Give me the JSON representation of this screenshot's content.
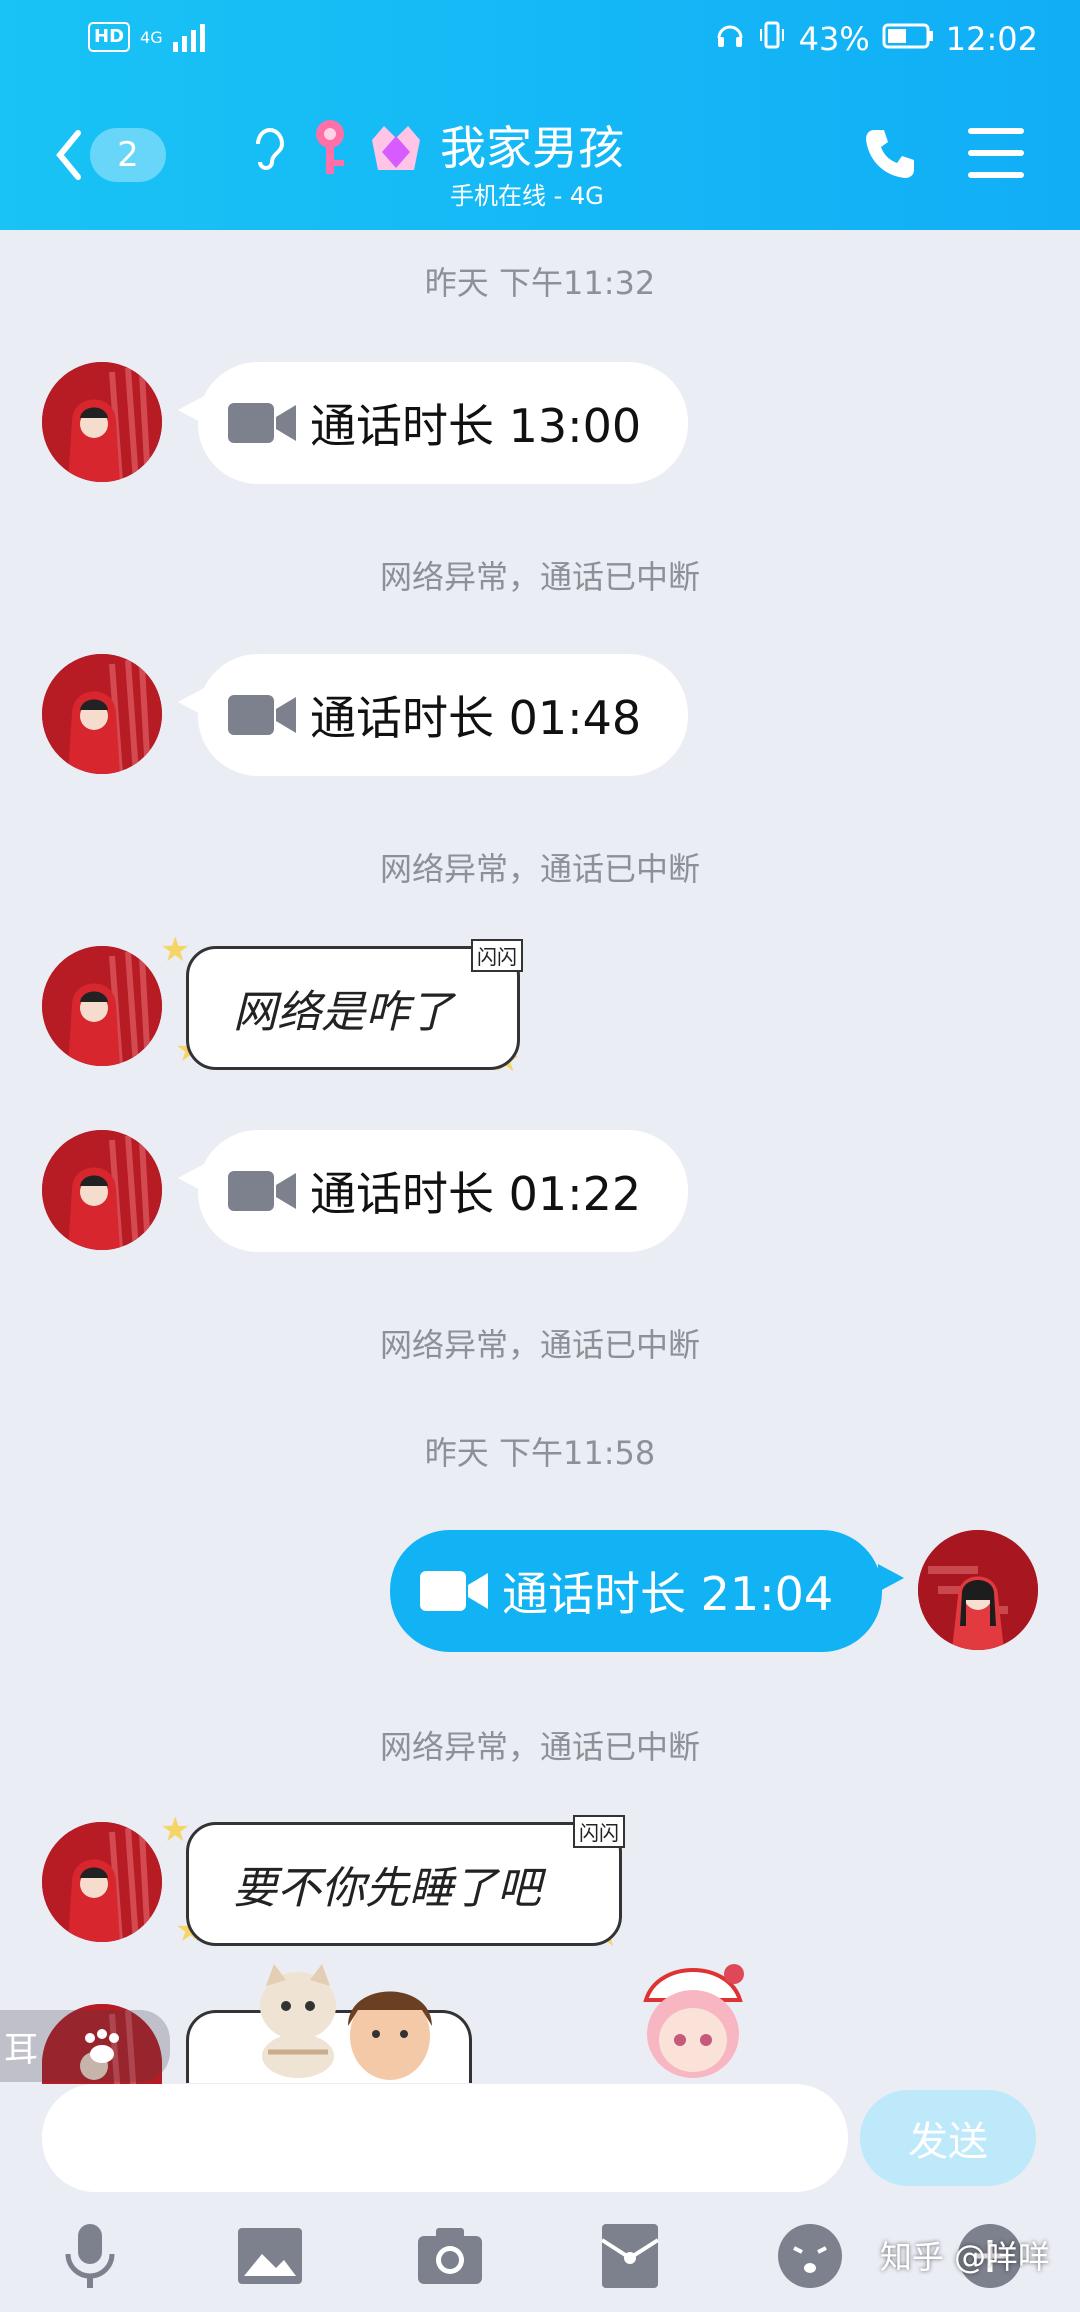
{
  "status_bar": {
    "hd": "HD",
    "network": "4G",
    "battery": "43%",
    "time": "12:02"
  },
  "header": {
    "unread_badge": "2",
    "contact_name": "我家男孩",
    "status": "手机在线 - 4G"
  },
  "messages": {
    "ts1": "昨天 下午11:32",
    "call1": "通话时长 13:00",
    "sys1": "网络异常，通话已中断",
    "call2": "通话时长 01:48",
    "sys2": "网络异常，通话已中断",
    "flash1": "网络是咋了",
    "flash_tag": "闪闪",
    "call3": "通话时长 01:22",
    "sys3": "网络异常，通话已中断",
    "ts2": "昨天 下午11:58",
    "call4": "通话时长 21:04",
    "sys4": "网络异常，通话已中断",
    "flash2": "要不你先睡了吧"
  },
  "input": {
    "placeholder": "",
    "send_label": "发送"
  },
  "ear_tab": "耳",
  "watermark": "知乎 @咩咩",
  "toolbar": {
    "icons": [
      "microphone-icon",
      "image-icon",
      "camera-icon",
      "red-packet-icon",
      "emoji-icon",
      "plus-icon"
    ]
  },
  "colors": {
    "header": "#19c3f5",
    "my_bubble": "#12b3f4",
    "background": "#ebedf5"
  }
}
